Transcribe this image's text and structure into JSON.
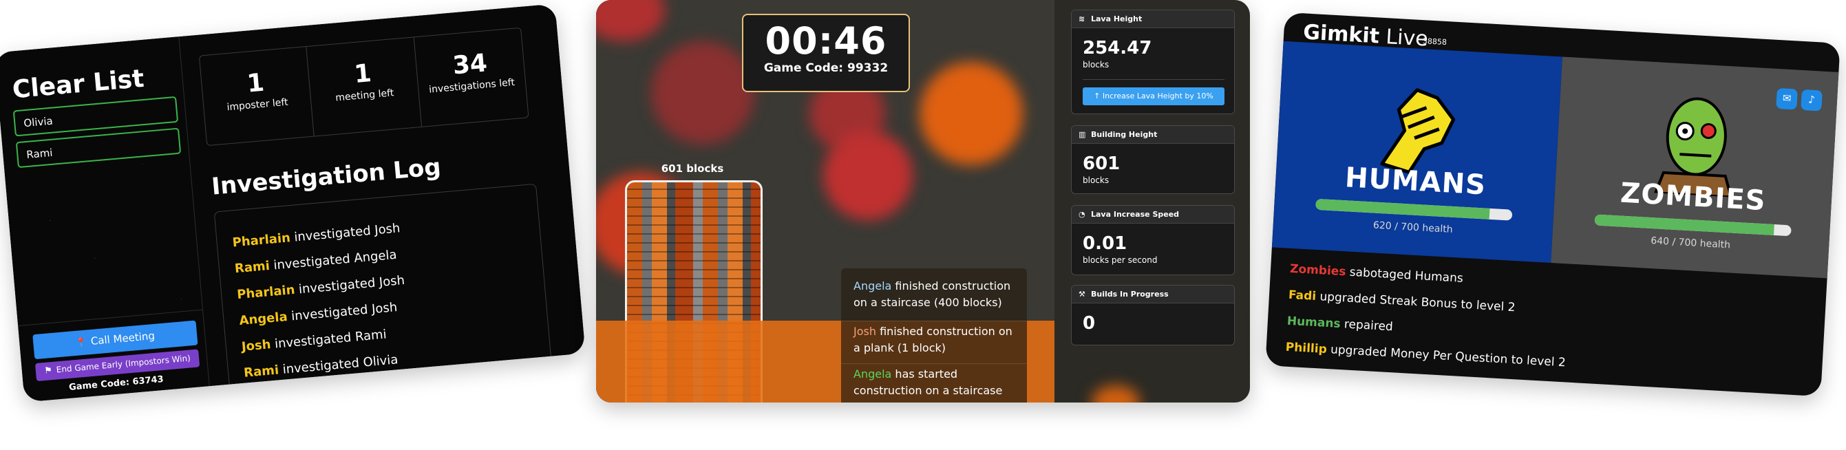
{
  "clear_list_card": {
    "title": "Clear List",
    "fields": [
      "Olivia",
      "Rami"
    ],
    "stats": [
      {
        "value": "1",
        "label": "imposter left"
      },
      {
        "value": "1",
        "label": "meeting left"
      },
      {
        "value": "34",
        "label": "investigations left"
      }
    ],
    "log_title": "Investigation Log",
    "log": [
      {
        "who": "Pharlain",
        "text": " investigated Josh"
      },
      {
        "who": "Rami",
        "text": " investigated Angela"
      },
      {
        "who": "Pharlain",
        "text": " investigated Josh"
      },
      {
        "who": "Angela",
        "text": " investigated Josh"
      },
      {
        "who": "Josh",
        "text": " investigated Rami"
      },
      {
        "who": "Rami",
        "text": " investigated Olivia"
      }
    ],
    "call_meeting": "Call Meeting",
    "end_game": "End Game Early (Impostors Win)",
    "game_code": "Game Code: 63743",
    "colors": {
      "name_highlight": "#f5c518",
      "call_button": "#2f8cf0",
      "end_button": "#7a3fc8",
      "field_border": "#3ab54a"
    }
  },
  "lava_card": {
    "timer": "00:46",
    "game_code": "Game Code: 99332",
    "tower_label": "601 blocks",
    "feed": [
      {
        "who": "Angela",
        "who_color": "#a7d8ff",
        "text": " finished construction on a staircase (400 blocks)"
      },
      {
        "who": "Josh",
        "who_color": "#f5a07a",
        "text": " finished construction on a plank (1 block)"
      },
      {
        "who": "Angela",
        "who_color": "#5cd65c",
        "text": " has started construction on a staircase"
      }
    ],
    "panels": {
      "lava_height": {
        "title": "Lava Height",
        "value": "254.47",
        "unit": "blocks",
        "button": "Increase Lava Height by 10%"
      },
      "building_height": {
        "title": "Building Height",
        "value": "601",
        "unit": "blocks"
      },
      "lava_speed": {
        "title": "Lava Increase Speed",
        "value": "0.01",
        "unit": "blocks per second"
      },
      "builds": {
        "title": "Builds In Progress",
        "value": "0"
      }
    }
  },
  "gimkit_card": {
    "logo": "Gimkit",
    "logo_live": " Live",
    "code": "38858",
    "humans": {
      "name": "HUMANS",
      "health": "620 / 700 health",
      "fraction": 0.886
    },
    "zombies": {
      "name": "ZOMBIES",
      "health": "640 / 700 health",
      "fraction": 0.914
    },
    "log": [
      {
        "who": "Zombies",
        "color": "#e53935",
        "text": " sabotaged Humans"
      },
      {
        "who": "Fadi",
        "color": "#f5c518",
        "text": " upgraded Streak Bonus to level 2"
      },
      {
        "who": "Humans",
        "color": "#5cb85c",
        "text": " repaired"
      },
      {
        "who": "Phillip",
        "color": "#f5c518",
        "text": " upgraded Money Per Question to level 2"
      }
    ]
  }
}
